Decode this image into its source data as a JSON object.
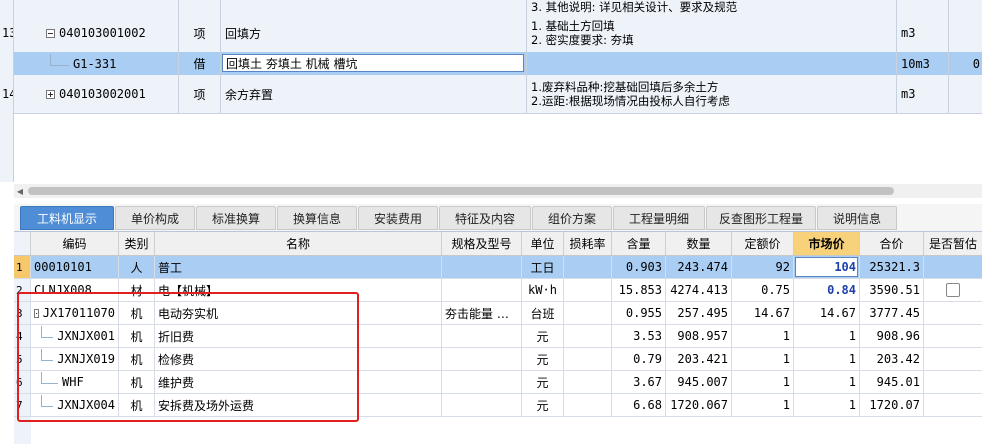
{
  "top_rows": [
    {
      "row_num": "",
      "code": "",
      "type": "",
      "name": "",
      "desc": [
        "3. 其他说明: 详见相关设计、要求及规范"
      ],
      "unit": ""
    },
    {
      "row_num": "13",
      "code": "040103001002",
      "type": "项",
      "name": "回填方",
      "desc": [
        "1. 基础土方回填",
        "2. 密实度要求: 夯填"
      ],
      "unit": "m3"
    },
    {
      "row_num": "",
      "code": "G1-331",
      "type": "借",
      "name": "回填土 夯填土 机械 槽坑",
      "desc": [],
      "unit": "10m3",
      "extra": "0"
    },
    {
      "row_num": "14",
      "code": "040103002001",
      "type": "项",
      "name": "余方弃置",
      "desc": [
        "1.废弃料品种:挖基础回填后多余土方",
        "2.运距:根据现场情况由投标人自行考虑"
      ],
      "unit": "m3"
    }
  ],
  "tabs": [
    "工料机显示",
    "单价构成",
    "标准换算",
    "换算信息",
    "安装费用",
    "特征及内容",
    "组价方案",
    "工程量明细",
    "反查图形工程量",
    "说明信息"
  ],
  "columns": [
    "编码",
    "类别",
    "名称",
    "规格及型号",
    "单位",
    "损耗率",
    "含量",
    "数量",
    "定额价",
    "市场价",
    "合价",
    "是否暂估"
  ],
  "rows": [
    {
      "n": "1",
      "code": "00010101",
      "cat": "人",
      "name": "普工",
      "spec": "",
      "unit": "工日",
      "loss": "",
      "qty": "0.903",
      "amount": "243.474",
      "quota": "92",
      "market": "104",
      "total": "25321.3",
      "est": false
    },
    {
      "n": "2",
      "code": "CLNJX008",
      "cat": "材",
      "name": "电【机械】",
      "spec": "",
      "unit": "kW·h",
      "loss": "",
      "qty": "15.853",
      "amount": "4274.413",
      "quota": "0.75",
      "market": "0.84",
      "total": "3590.51",
      "est": true
    },
    {
      "n": "3",
      "code": "JX17011070",
      "cat": "机",
      "name": "电动夯实机",
      "spec": "夯击能量 …",
      "unit": "台班",
      "loss": "",
      "qty": "0.955",
      "amount": "257.495",
      "quota": "14.67",
      "market": "14.67",
      "total": "3777.45",
      "est": false
    },
    {
      "n": "4",
      "code": "JXNJX001",
      "cat": "机",
      "name": "折旧费",
      "spec": "",
      "unit": "元",
      "loss": "",
      "qty": "3.53",
      "amount": "908.957",
      "quota": "1",
      "market": "1",
      "total": "908.96",
      "est": false
    },
    {
      "n": "5",
      "code": "JXNJX019",
      "cat": "机",
      "name": "检修费",
      "spec": "",
      "unit": "元",
      "loss": "",
      "qty": "0.79",
      "amount": "203.421",
      "quota": "1",
      "market": "1",
      "total": "203.42",
      "est": false
    },
    {
      "n": "6",
      "code": "WHF",
      "cat": "机",
      "name": "维护费",
      "spec": "",
      "unit": "元",
      "loss": "",
      "qty": "3.67",
      "amount": "945.007",
      "quota": "1",
      "market": "1",
      "total": "945.01",
      "est": false
    },
    {
      "n": "7",
      "code": "JXNJX004",
      "cat": "机",
      "name": "安拆费及场外运费",
      "spec": "",
      "unit": "元",
      "loss": "",
      "qty": "6.68",
      "amount": "1720.067",
      "quota": "1",
      "market": "1",
      "total": "1720.07",
      "est": false
    }
  ],
  "colors": {
    "accent": "#4f8ed6",
    "selected_row": "#a9cdf3",
    "highlight_box": "#e02020",
    "market_header": "#f7d27a"
  }
}
